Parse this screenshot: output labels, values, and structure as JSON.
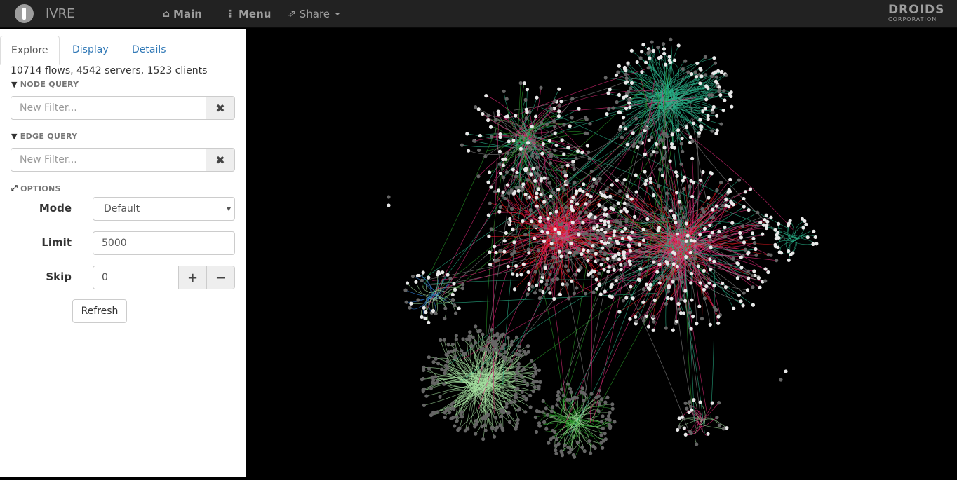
{
  "app": {
    "name": "IVRE"
  },
  "nav": {
    "main": "Main",
    "menu": "Menu",
    "share": "Share"
  },
  "partner": {
    "line1": "DROIDS",
    "line2": "CORPORATION"
  },
  "tabs": [
    {
      "label": "Explore"
    },
    {
      "label": "Display"
    },
    {
      "label": "Details"
    }
  ],
  "summary": "10714 flows, 4542 servers, 1523 clients",
  "node_query": {
    "label": "NODE QUERY",
    "placeholder": "New Filter..."
  },
  "edge_query": {
    "label": "EDGE QUERY",
    "placeholder": "New Filter..."
  },
  "options": {
    "label": "OPTIONS",
    "mode": {
      "label": "Mode",
      "value": "Default"
    },
    "limit": {
      "label": "Limit",
      "value": "5000"
    },
    "skip": {
      "label": "Skip",
      "value": "0"
    },
    "refresh": "Refresh"
  },
  "graph": {
    "colors": {
      "node_light": "#e8e8e8",
      "node_dark": "#666666",
      "edge_red": "#e8171d",
      "edge_pink": "#e0297a",
      "edge_teal": "#2ab38a",
      "edge_green": "#2a9d2a",
      "edge_lightgreen": "#a6e0a0",
      "edge_blue": "#2d7bd1",
      "edge_gray": "#888888"
    }
  }
}
